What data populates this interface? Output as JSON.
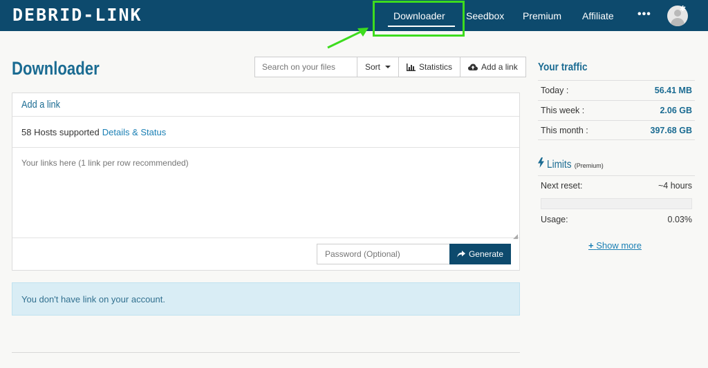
{
  "brand": {
    "logo_text": "DEBRID-LINK"
  },
  "nav": {
    "items": [
      {
        "label": "Downloader",
        "active": true
      },
      {
        "label": "Seedbox"
      },
      {
        "label": "Premium"
      },
      {
        "label": "Affiliate"
      }
    ],
    "more_label": "•••"
  },
  "colors": {
    "header_bg": "#0d4a6d",
    "accent": "#1a6b92",
    "highlight": "#3ddc1e",
    "info_bg": "#d9edf5"
  },
  "page": {
    "title": "Downloader"
  },
  "toolbar": {
    "search_placeholder": "Search on your files",
    "sort_label": "Sort",
    "statistics_label": "Statistics",
    "add_link_label": "Add a link"
  },
  "add_panel": {
    "title": "Add a link",
    "hosts_text": "58 Hosts supported",
    "hosts_link": "Details & Status",
    "links_placeholder": "Your links here (1 link per row recommended)",
    "password_placeholder": "Password (Optional)",
    "generate_label": "Generate"
  },
  "alert": {
    "text": "You don't have link on your account."
  },
  "traffic": {
    "title": "Your traffic",
    "rows": [
      {
        "label": "Today :",
        "value": "56.41 MB"
      },
      {
        "label": "This week :",
        "value": "2.06 GB"
      },
      {
        "label": "This month :",
        "value": "397.68 GB"
      }
    ]
  },
  "limits": {
    "title": "Limits",
    "badge": "(Premium)",
    "next_reset_label": "Next reset:",
    "next_reset_value": "~4 hours",
    "usage_label": "Usage:",
    "usage_value": "0.03%",
    "usage_fraction": 0.0003,
    "show_more": "Show more"
  }
}
